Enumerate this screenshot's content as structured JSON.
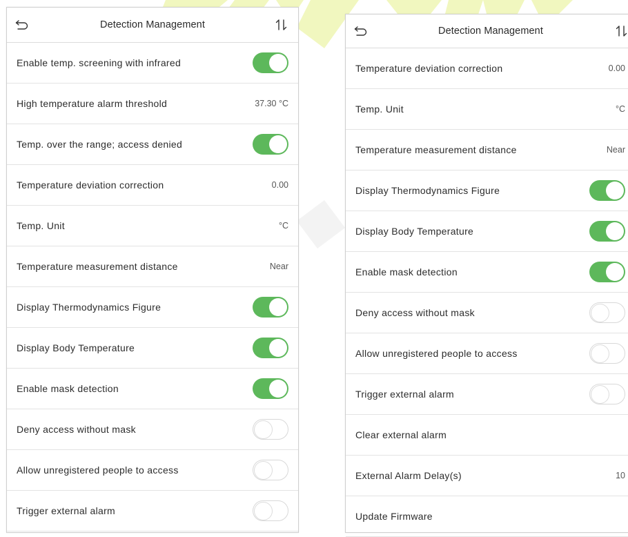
{
  "colors": {
    "toggle_on": "#5db85b",
    "toggle_off_border": "#d8d8d8",
    "watermark": "#f1f7bf"
  },
  "left": {
    "title": "Detection Management",
    "back_icon": "return-arrow-icon",
    "sort_icon": "sort-arrows-icon",
    "rows": [
      {
        "label": "Enable temp. screening with infrared",
        "toggle": "on"
      },
      {
        "label": "High temperature alarm threshold",
        "value": "37.30 °C"
      },
      {
        "label": "Temp. over the range; access denied",
        "toggle": "on"
      },
      {
        "label": "Temperature deviation correction",
        "value": "0.00"
      },
      {
        "label": "Temp. Unit",
        "value": "°C"
      },
      {
        "label": "Temperature measurement distance",
        "value": "Near"
      },
      {
        "label": "Display Thermodynamics Figure",
        "toggle": "on"
      },
      {
        "label": "Display Body Temperature",
        "toggle": "on"
      },
      {
        "label": "Enable mask detection",
        "toggle": "on"
      },
      {
        "label": "Deny access without mask",
        "toggle": "off"
      },
      {
        "label": "Allow unregistered people to access",
        "toggle": "off"
      },
      {
        "label": "Trigger external alarm",
        "toggle": "off"
      }
    ]
  },
  "right": {
    "title": "Detection Management",
    "back_icon": "return-arrow-icon",
    "sort_icon": "sort-arrows-icon",
    "rows": [
      {
        "label": "Temperature deviation correction",
        "value": "0.00"
      },
      {
        "label": "Temp. Unit",
        "value": "°C"
      },
      {
        "label": "Temperature measurement distance",
        "value": "Near"
      },
      {
        "label": "Display Thermodynamics Figure",
        "toggle": "on"
      },
      {
        "label": "Display Body Temperature",
        "toggle": "on"
      },
      {
        "label": "Enable mask detection",
        "toggle": "on"
      },
      {
        "label": "Deny access without mask",
        "toggle": "off"
      },
      {
        "label": "Allow unregistered people to access",
        "toggle": "off"
      },
      {
        "label": "Trigger external alarm",
        "toggle": "off"
      },
      {
        "label": "Clear external alarm"
      },
      {
        "label": "External Alarm Delay(s)",
        "value": "10"
      },
      {
        "label": "Update Firmware"
      }
    ]
  }
}
